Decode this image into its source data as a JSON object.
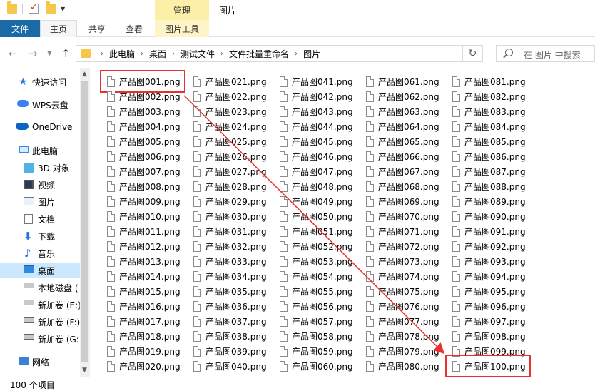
{
  "window": {
    "title": "图片",
    "context_tab": "管理"
  },
  "ribbon": {
    "tabs": [
      "文件",
      "主页",
      "共享",
      "查看",
      "图片工具"
    ]
  },
  "address": {
    "crumbs": [
      "此电脑",
      "桌面",
      "测试文件",
      "文件批量重命名",
      "图片"
    ],
    "search_placeholder": "在 图片 中搜索"
  },
  "nav": {
    "items": [
      {
        "label": "快速访问",
        "icon": "star-icon"
      },
      {
        "label": "WPS云盘",
        "icon": "wps-cloud-icon"
      },
      {
        "label": "OneDrive",
        "icon": "onedrive-cloud-icon"
      },
      {
        "label": "此电脑",
        "icon": "computer-icon"
      },
      {
        "label": "3D 对象",
        "icon": "cube-icon"
      },
      {
        "label": "视频",
        "icon": "video-icon"
      },
      {
        "label": "图片",
        "icon": "picture-icon"
      },
      {
        "label": "文档",
        "icon": "document-icon"
      },
      {
        "label": "下载",
        "icon": "download-arrow-icon"
      },
      {
        "label": "音乐",
        "icon": "music-note-icon"
      },
      {
        "label": "桌面",
        "icon": "desktop-icon"
      },
      {
        "label": "本地磁盘 (",
        "icon": "drive-icon"
      },
      {
        "label": "新加卷 (E:)",
        "icon": "drive-icon"
      },
      {
        "label": "新加卷 (F:)",
        "icon": "drive-icon"
      },
      {
        "label": "新加卷 (G:",
        "icon": "drive-icon"
      },
      {
        "label": "网络",
        "icon": "network-icon"
      }
    ],
    "selected": "桌面"
  },
  "files": {
    "prefix": "产品图",
    "extension": ".png",
    "count": 100,
    "rows_per_column": 20,
    "highlighted": [
      "产品图001.png",
      "产品图100.png"
    ]
  },
  "status": {
    "item_count": "100 个项目"
  },
  "colors": {
    "file_tab": "#1a6aa5",
    "selection": "#cce8ff",
    "highlight": "#e8302f",
    "context_tab": "#fcefa8"
  }
}
